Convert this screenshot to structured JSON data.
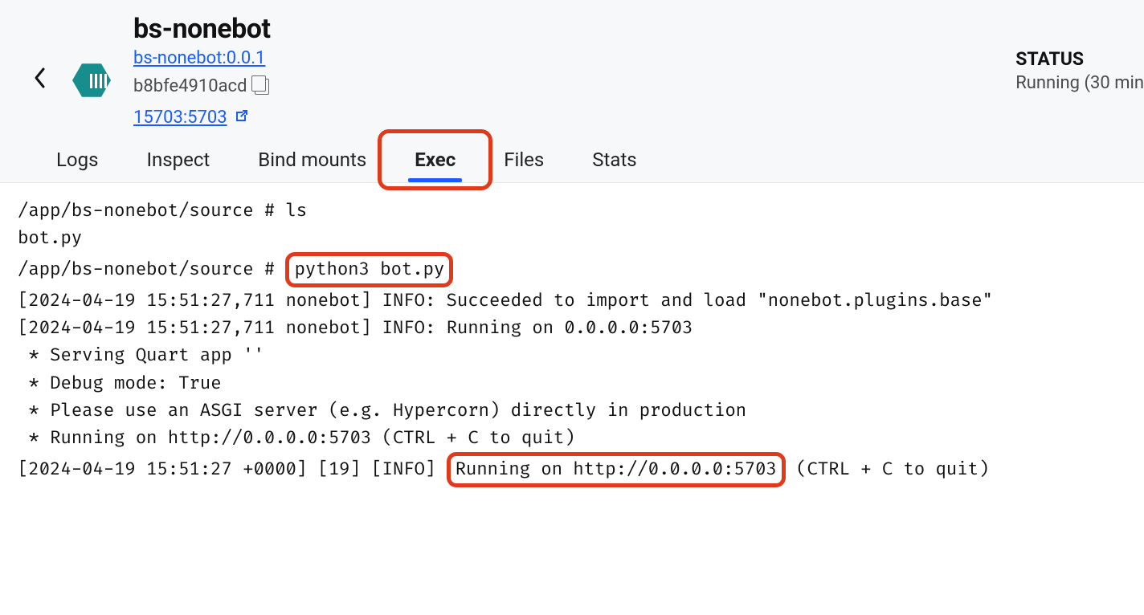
{
  "header": {
    "title": "bs-nonebot",
    "image_link": "bs-nonebot:0.0.1",
    "hash": "b8bfe4910acd",
    "port_link": "15703:5703",
    "status_label": "STATUS",
    "status_value": "Running (30 min"
  },
  "tabs": {
    "items": [
      {
        "label": "Logs"
      },
      {
        "label": "Inspect"
      },
      {
        "label": "Bind mounts"
      },
      {
        "label": "Exec"
      },
      {
        "label": "Files"
      },
      {
        "label": "Stats"
      }
    ],
    "active_index": 3
  },
  "terminal": {
    "line0_prompt": "/app/bs-nonebot/source # ",
    "line0_cmd": "ls",
    "line1": "bot.py",
    "line2_prompt": "/app/bs-nonebot/source # ",
    "line2_cmd": "python3 bot.py",
    "line3": "[2024-04-19 15:51:27,711 nonebot] INFO: Succeeded to import and load \"nonebot.plugins.base\"",
    "line4": "[2024-04-19 15:51:27,711 nonebot] INFO: Running on 0.0.0.0:5703",
    "line5": " * Serving Quart app ''",
    "line6": " * Debug mode: True",
    "line7": " * Please use an ASGI server (e.g. Hypercorn) directly in production",
    "line8": " * Running on http://0.0.0.0:5703 (CTRL + C to quit)",
    "line9_pre": "[2024-04-19 15:51:27 +0000] [19] [INFO] ",
    "line9_hl": "Running on http://0.0.0.0:5703",
    "line9_post": " (CTRL + C to quit)"
  }
}
